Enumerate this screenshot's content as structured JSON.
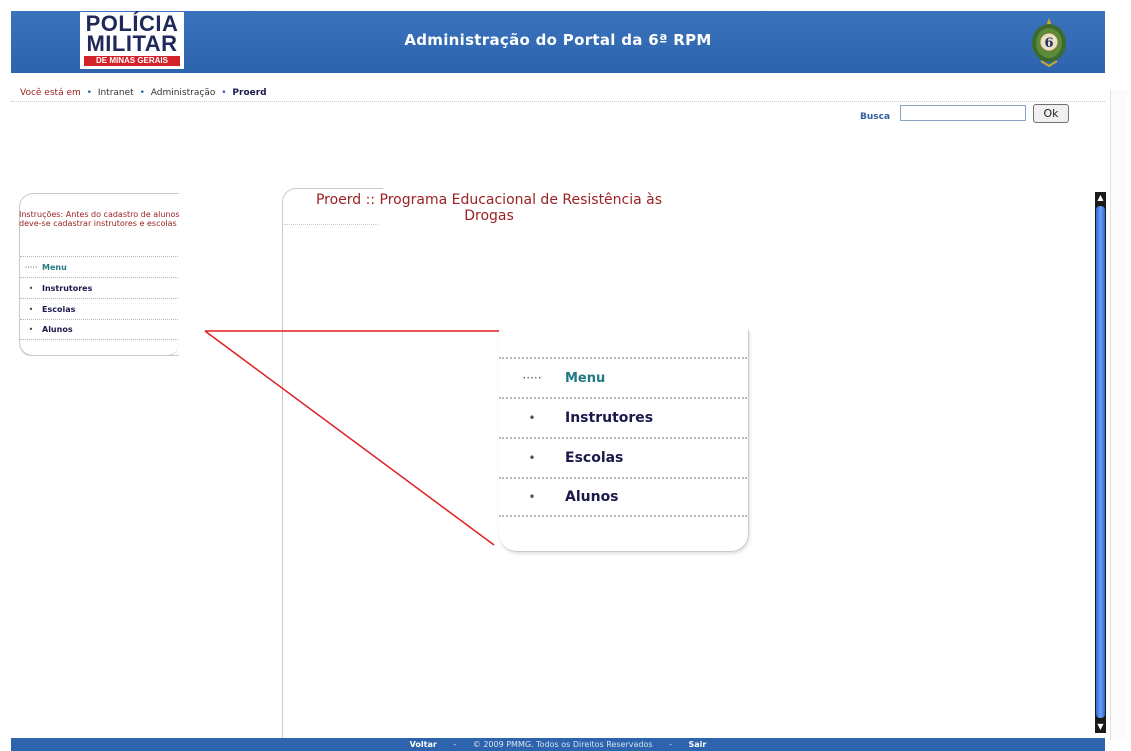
{
  "header": {
    "logo_line1": "POLÍCIA",
    "logo_line2": "MILITAR",
    "logo_line3": "DE MINAS GERAIS",
    "title": "Administração do Portal da 6ª RPM",
    "emblem_number": "6",
    "background_color": "#2d64ad"
  },
  "breadcrumb": {
    "prefix": "Você está em",
    "items": [
      "Intranet",
      "Administração",
      "Proerd"
    ]
  },
  "search": {
    "label": "Busca",
    "value": "",
    "button_label": "Ok"
  },
  "sidebar": {
    "instructions": "Instruções: Antes do cadastro de alunos deve-se cadastrar instrutores e escolas",
    "menu_heading": "Menu",
    "items": [
      "Instrutores",
      "Escolas",
      "Alunos"
    ]
  },
  "content": {
    "title": "Proerd :: Programa Educacional de Resistência às Drogas"
  },
  "zoom_menu": {
    "menu_heading": "Menu",
    "items": [
      "Instrutores",
      "Escolas",
      "Alunos"
    ]
  },
  "footer": {
    "back_label": "Voltar",
    "copyright": "© 2009 PMMG. Todos os Direitos Reservados",
    "exit_label": "Sair"
  },
  "colors": {
    "accent_blue": "#2d64ad",
    "dark_red_text": "#9a2222",
    "teal_menu": "#1f7a82",
    "callout_red": "#e02020"
  },
  "icons": {
    "emblem": "rpm-emblem-icon",
    "bullet": "bullet-icon",
    "scroll_up": "scroll-up-icon",
    "scroll_down": "scroll-down-icon"
  }
}
